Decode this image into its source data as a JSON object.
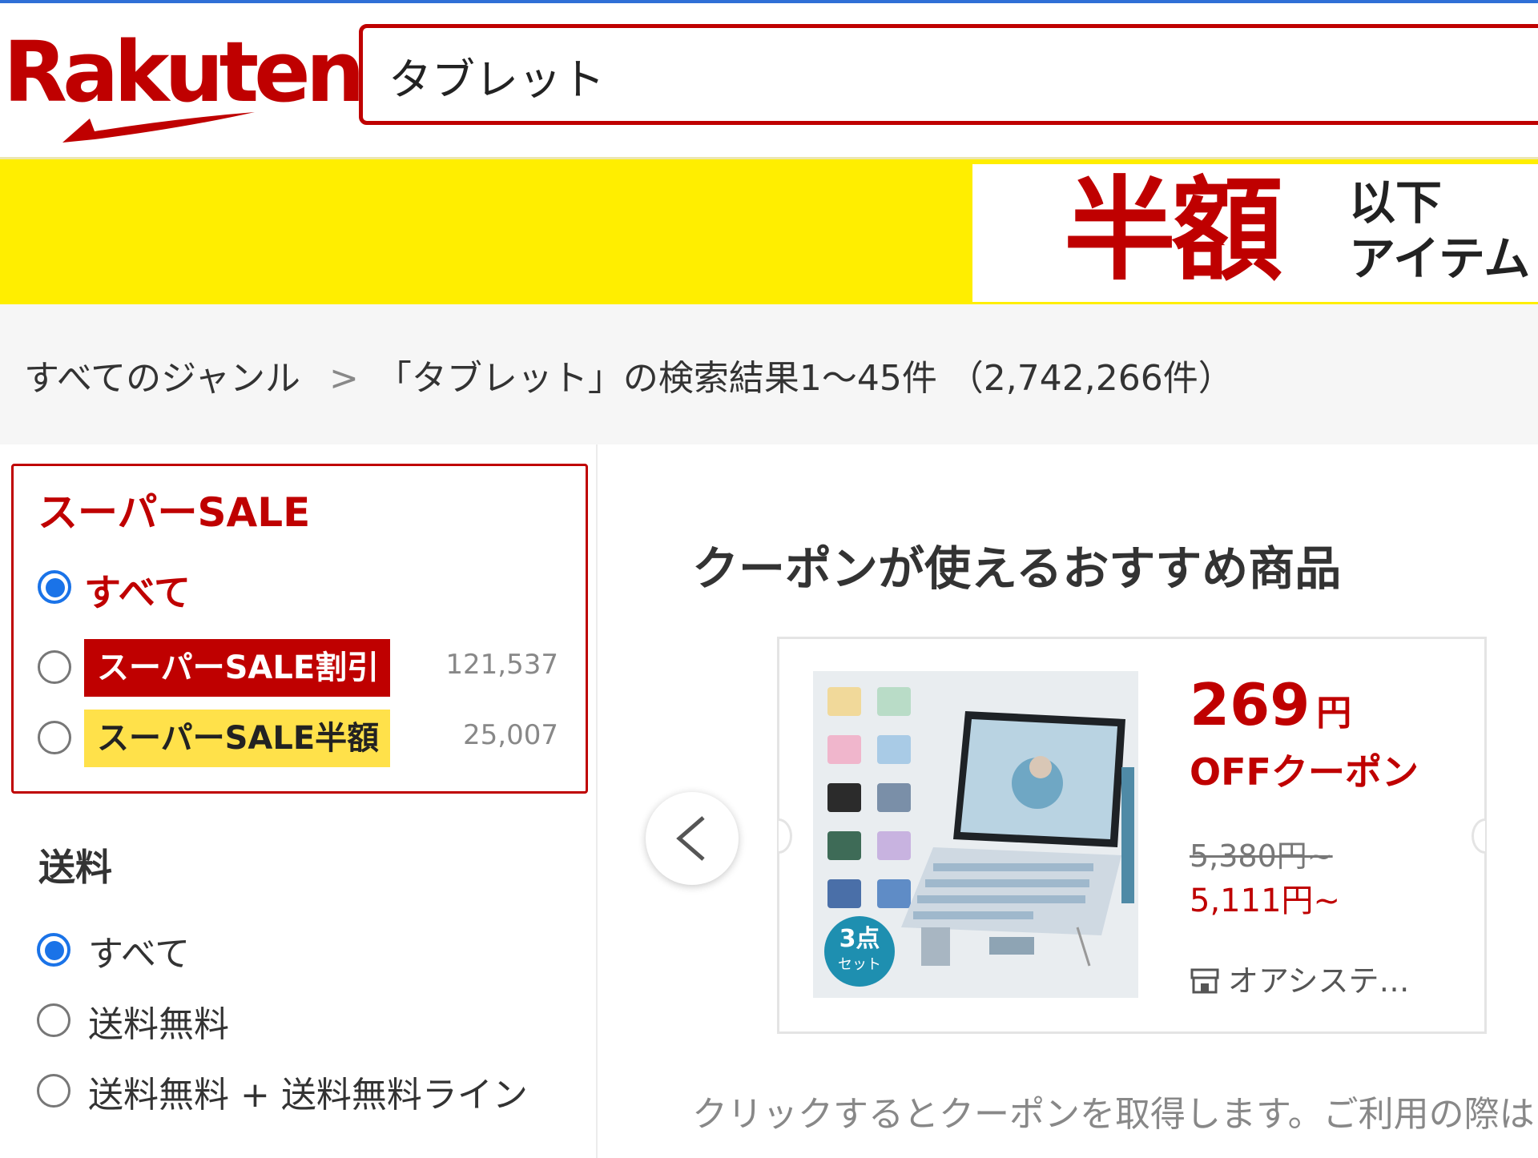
{
  "header": {
    "logo_text": "Rakuten",
    "search_value": "タブレット"
  },
  "banner": {
    "big_text": "半額",
    "small_line1": "以下",
    "small_line2": "アイテム"
  },
  "breadcrumb": {
    "root": "すべてのジャンル",
    "separator": ">",
    "result_text": "「タブレット」の検索結果1～45件 （2,742,266件）"
  },
  "sidebar": {
    "sale_section": {
      "title": "スーパーSALE",
      "options": [
        {
          "label": "すべて",
          "selected": true
        },
        {
          "label": "スーパーSALE割引",
          "count": "121,537",
          "selected": false
        },
        {
          "label": "スーパーSALE半額",
          "count": "25,007",
          "selected": false
        }
      ]
    },
    "shipping_section": {
      "title": "送料",
      "options": [
        {
          "label": "すべて",
          "selected": true
        },
        {
          "label": "送料無料",
          "selected": false
        },
        {
          "label": "送料無料 + 送料無料ライン",
          "selected": false
        }
      ]
    }
  },
  "main": {
    "section_title": "クーポンが使えるおすすめ商品",
    "product": {
      "discount_value": "269",
      "discount_unit": "円",
      "coupon_label": "OFFクーポン",
      "original_price": "5,380円~",
      "sale_price": "5,111円~",
      "shop_name": "オアシステ…",
      "image_badge": "3点 セット"
    },
    "notice": "クリックするとクーポンを取得します。ご利用の際は"
  },
  "colors": {
    "brand_red": "#bf0000",
    "banner_yellow": "#ffee00",
    "radio_blue": "#1a73e8",
    "tag_yellow": "#ffe14a"
  },
  "icons": {
    "prev": "chevron-left-icon",
    "shop": "shop-icon"
  }
}
